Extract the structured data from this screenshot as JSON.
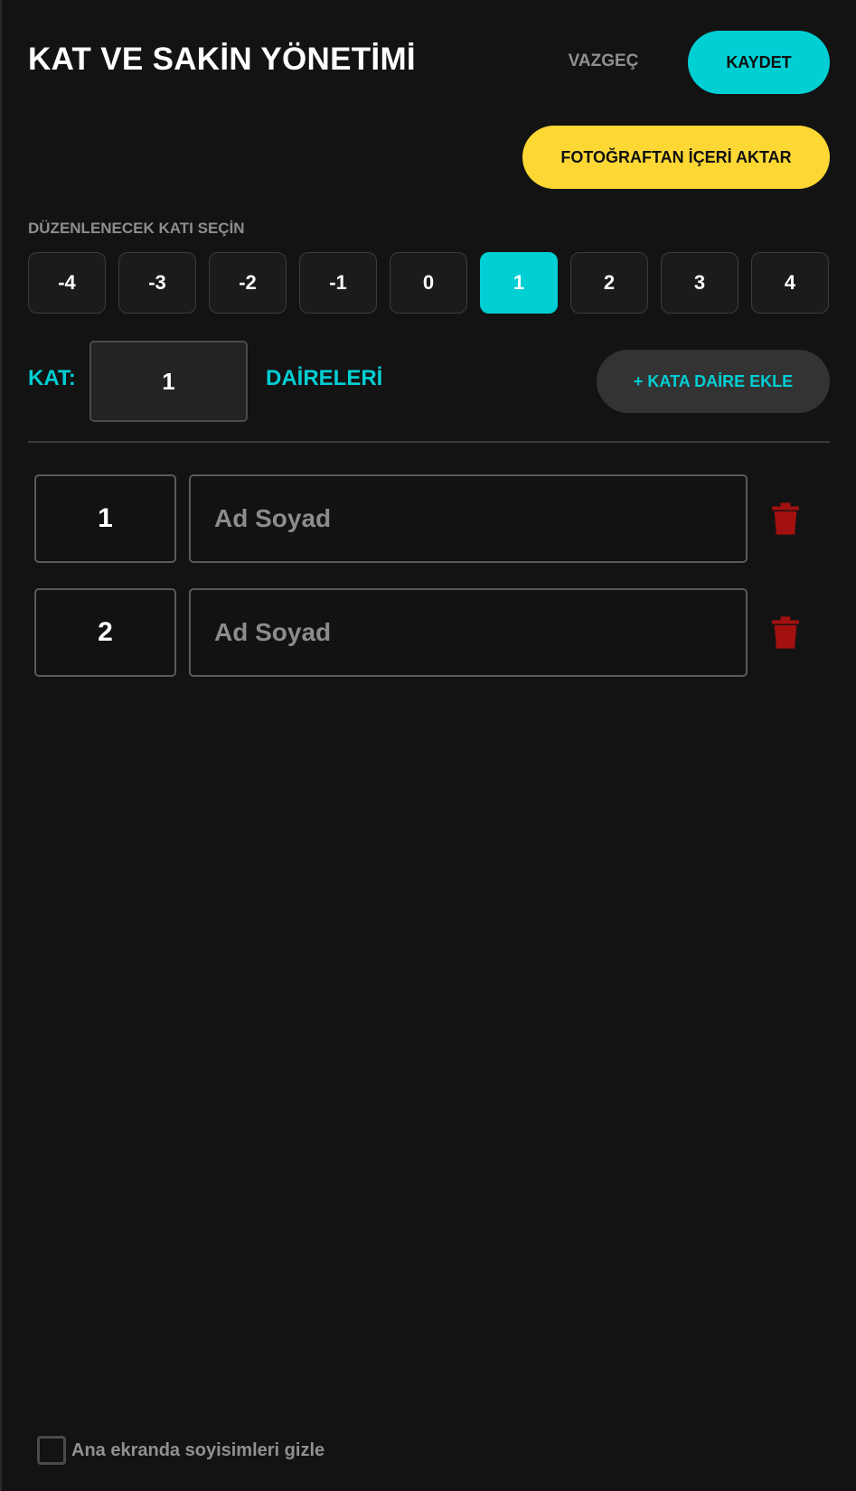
{
  "header": {
    "title": "KAT VE SAKİN YÖNETİMİ",
    "cancel_label": "VAZGEÇ",
    "save_label": "KAYDET"
  },
  "import_button_label": "FOTOĞRAFTAN İÇERİ AKTAR",
  "floor_selector": {
    "label": "DÜZENLENECEK KATI SEÇİN",
    "floors": [
      "-4",
      "-3",
      "-2",
      "-1",
      "0",
      "1",
      "2",
      "3",
      "4"
    ],
    "selected": "1"
  },
  "floor_editor": {
    "kat_label": "KAT:",
    "kat_value": "1",
    "daireleri_label": "DAİRELERİ",
    "add_unit_label": "+ KATA DAİRE EKLE"
  },
  "units": [
    {
      "number": "1",
      "name_value": "",
      "name_placeholder": "Ad Soyad"
    },
    {
      "number": "2",
      "name_value": "",
      "name_placeholder": "Ad Soyad"
    }
  ],
  "hide_surnames": {
    "label": "Ana ekranda soyisimleri gizle",
    "checked": false
  },
  "colors": {
    "background": "#131313",
    "accent": "#00cfd4",
    "import_yellow": "#fdd835",
    "delete_red": "#a31010"
  }
}
